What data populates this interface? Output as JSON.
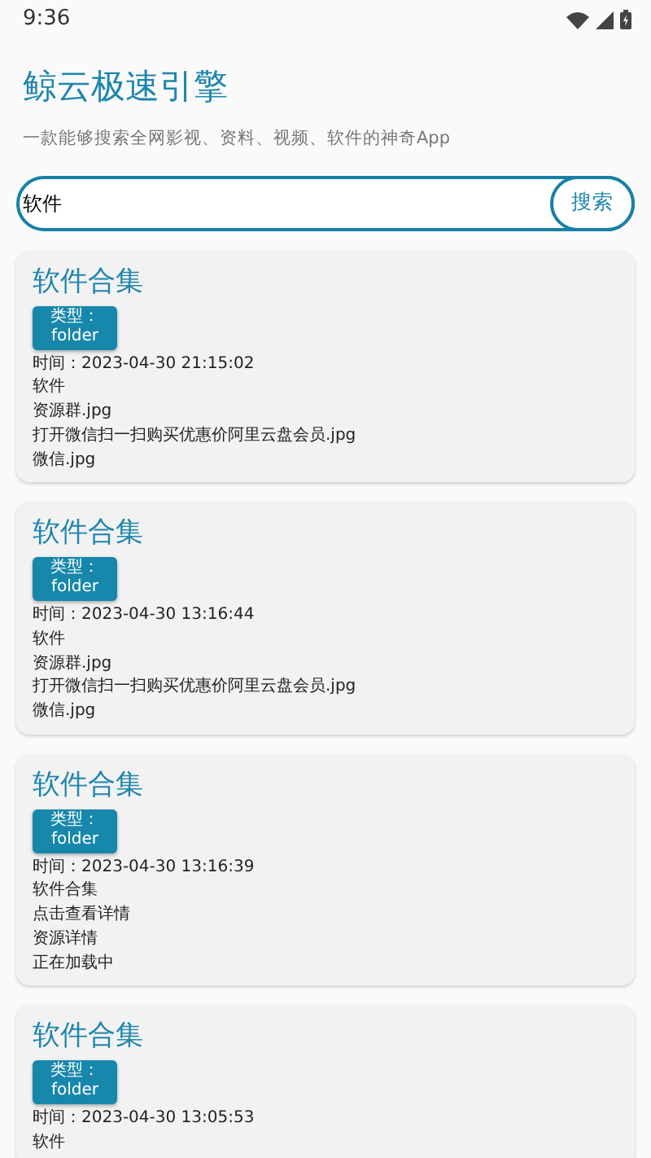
{
  "status_bar": {
    "time": "9:36"
  },
  "header": {
    "title": "鲸云极速引擎",
    "subtitle": "一款能够搜索全网影视、资料、视频、软件的神奇App"
  },
  "search": {
    "value": "软件",
    "button": "搜索"
  },
  "results": [
    {
      "title": "软件合集",
      "type_label": "类型：",
      "type_value": "folder",
      "time": "时间：2023-04-30 21:15:02",
      "lines": [
        "软件",
        "资源群.jpg",
        "打开微信扫一扫购买优惠价阿里云盘会员.jpg",
        "微信.jpg"
      ]
    },
    {
      "title": "软件合集",
      "type_label": "类型：",
      "type_value": "folder",
      "time": "时间：2023-04-30 13:16:44",
      "lines": [
        "软件",
        "资源群.jpg",
        "打开微信扫一扫购买优惠价阿里云盘会员.jpg",
        "微信.jpg"
      ]
    },
    {
      "title": "软件合集",
      "type_label": "类型：",
      "type_value": "folder",
      "time": "时间：2023-04-30 13:16:39",
      "lines": [
        "软件合集",
        "点击查看详情",
        "资源详情",
        "正在加载中"
      ]
    },
    {
      "title": "软件合集",
      "type_label": "类型：",
      "type_value": "folder",
      "time": "时间：2023-04-30 13:05:53",
      "lines": [
        "软件"
      ]
    }
  ]
}
